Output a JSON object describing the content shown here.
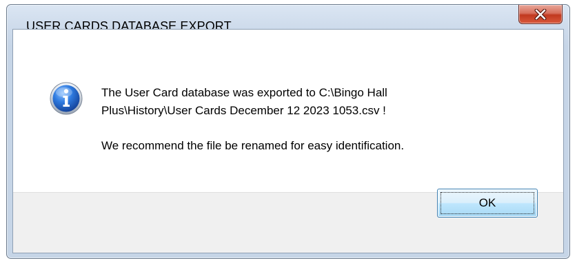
{
  "window": {
    "title": "USER CARDS DATABASE EXPORT"
  },
  "message": {
    "line1": "The User Card database was exported to C:\\Bingo Hall",
    "line2": "Plus\\History\\User Cards December 12 2023 1053.csv !",
    "line3": "We recommend the file be renamed for easy identification."
  },
  "buttons": {
    "ok_label": "OK"
  },
  "icons": {
    "dialog_icon": "information-icon",
    "close_icon": "close-icon"
  },
  "colors": {
    "close_button": "#c7472d",
    "info_icon_blue": "#2b6fcf",
    "ok_border": "#3c7fb1"
  }
}
